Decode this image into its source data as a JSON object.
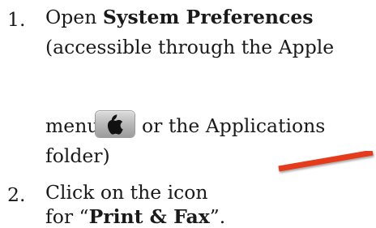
{
  "steps": [
    {
      "number": "1.",
      "prefix": "Open ",
      "bold": "System Preferences",
      "line2": "(accessible through the Apple",
      "line3_before_icon": "menu",
      "line3_after_icon": "or the Applications",
      "line4": "folder)"
    },
    {
      "number": "2.",
      "line1": "Click on the icon",
      "line2_before": "for “",
      "bold": "Print & Fax",
      "line2_after": "”."
    }
  ],
  "icons": {
    "apple_menu": "apple-logo-icon",
    "pointer": "red-arrow-icon"
  },
  "colors": {
    "text": "#1a1a1a",
    "arrow": "#e43a1f",
    "icon_bg": "#b8b8b8"
  }
}
